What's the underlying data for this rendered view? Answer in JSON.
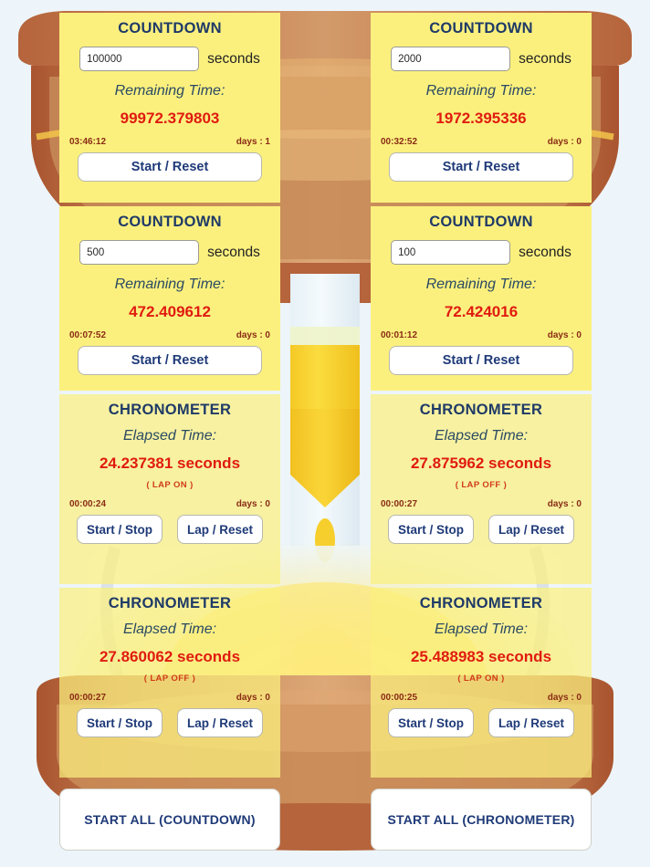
{
  "colors": {
    "panel_bg": "#FBF07E",
    "title": "#1F3A67",
    "value_red": "#E01B10",
    "clock_brown": "#8A2B15",
    "button_text": "#1F3A78",
    "background": "#EDF5FA"
  },
  "labels": {
    "seconds": "seconds",
    "remaining_time": "Remaining Time:",
    "elapsed_time": "Elapsed Time:",
    "countdown_title": "COUNTDOWN",
    "chronometer_title": "CHRONOMETER",
    "start_reset": "Start / Reset",
    "start_stop": "Start / Stop",
    "lap_reset": "Lap / Reset",
    "input_placeholder": "seconds"
  },
  "countdowns": [
    {
      "title": "COUNTDOWN",
      "input_value": "100000",
      "unit": "seconds",
      "label": "Remaining Time:",
      "remaining": "99972.379803",
      "clock": "03:46:12",
      "days": "days : 1",
      "button": "Start / Reset"
    },
    {
      "title": "COUNTDOWN",
      "input_value": "2000",
      "unit": "seconds",
      "label": "Remaining Time:",
      "remaining": "1972.395336",
      "clock": "00:32:52",
      "days": "days : 0",
      "button": "Start / Reset"
    },
    {
      "title": "COUNTDOWN",
      "input_value": "500",
      "unit": "seconds",
      "label": "Remaining Time:",
      "remaining": "472.409612",
      "clock": "00:07:52",
      "days": "days : 0",
      "button": "Start / Reset"
    },
    {
      "title": "COUNTDOWN",
      "input_value": "100",
      "unit": "seconds",
      "label": "Remaining Time:",
      "remaining": "72.424016",
      "clock": "00:01:12",
      "days": "days : 0",
      "button": "Start / Reset"
    }
  ],
  "chronometers": [
    {
      "title": "CHRONOMETER",
      "label": "Elapsed Time:",
      "elapsed": "24.237381 seconds",
      "lap_state": "( LAP ON )",
      "clock": "00:00:24",
      "days": "days : 0",
      "button_start": "Start / Stop",
      "button_lap": "Lap / Reset"
    },
    {
      "title": "CHRONOMETER",
      "label": "Elapsed Time:",
      "elapsed": "27.875962 seconds",
      "lap_state": "( LAP OFF )",
      "clock": "00:00:27",
      "days": "days : 0",
      "button_start": "Start / Stop",
      "button_lap": "Lap / Reset"
    },
    {
      "title": "CHRONOMETER",
      "label": "Elapsed Time:",
      "elapsed": "27.860062 seconds",
      "lap_state": "( LAP OFF )",
      "clock": "00:00:27",
      "days": "days : 0",
      "button_start": "Start / Stop",
      "button_lap": "Lap / Reset"
    },
    {
      "title": "CHRONOMETER",
      "label": "Elapsed Time:",
      "elapsed": "25.488983 seconds",
      "lap_state": "( LAP ON )",
      "clock": "00:00:25",
      "days": "days : 0",
      "button_start": "Start / Stop",
      "button_lap": "Lap / Reset"
    }
  ],
  "footer": {
    "start_all_countdown": "START ALL (COUNTDOWN)",
    "start_all_chronometer": "START ALL (CHRONOMETER)"
  },
  "background": {
    "illustration": "hourglass-sand-timer"
  }
}
